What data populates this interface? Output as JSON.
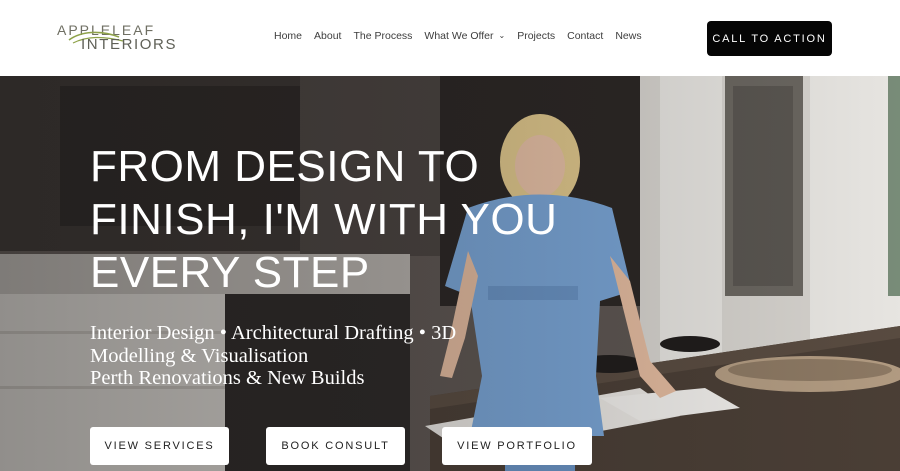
{
  "brand": {
    "logo_line1": "APPLELEAF",
    "logo_line2": "INTERIORS"
  },
  "nav": {
    "items": [
      {
        "label": "Home"
      },
      {
        "label": "About"
      },
      {
        "label": "The Process"
      },
      {
        "label": "What We Offer",
        "has_dropdown": true
      },
      {
        "label": "Projects"
      },
      {
        "label": "Contact"
      },
      {
        "label": "News"
      }
    ]
  },
  "header": {
    "cta_label": "CALL TO ACTION"
  },
  "hero": {
    "headline_lines": [
      "FROM DESIGN TO",
      "FINISH, I'M WITH YOU",
      "EVERY STEP"
    ],
    "subline_lines": [
      "Interior Design • Architectural Drafting • 3D",
      "Modelling & Visualisation",
      "Perth Renovations & New Builds"
    ],
    "buttons": {
      "services": "VIEW SERVICES",
      "consult": "BOOK CONSULT",
      "portfolio": "VIEW PORTFOLIO"
    }
  },
  "colors": {
    "cta_bg": "#050505",
    "logo_green": "#8fa34a",
    "hero_dress_blue": "#7aa6d8"
  }
}
